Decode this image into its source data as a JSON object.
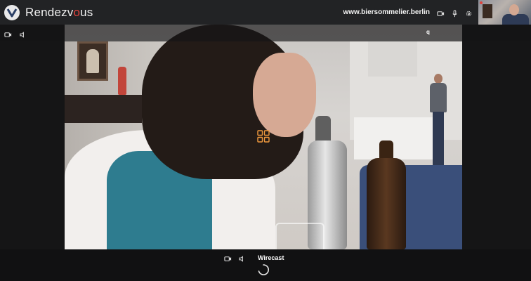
{
  "app": {
    "brand_prefix": "Rendezv",
    "brand_o": "o",
    "brand_suffix": "us",
    "accent_color": "#e0413b",
    "ui_accent_color": "#f19a3e"
  },
  "header": {
    "site": "www.biersommelier.berlin",
    "icons": [
      "camera-icon",
      "microphone-icon",
      "gear-icon"
    ]
  },
  "stage": {
    "participant_label": "q",
    "toolbar_icons": [
      "camera-icon",
      "speaker-icon"
    ]
  },
  "footer": {
    "camera_name": "Wirecast",
    "icons": [
      "camera-icon",
      "speaker-icon",
      "loading-spinner-icon"
    ]
  }
}
